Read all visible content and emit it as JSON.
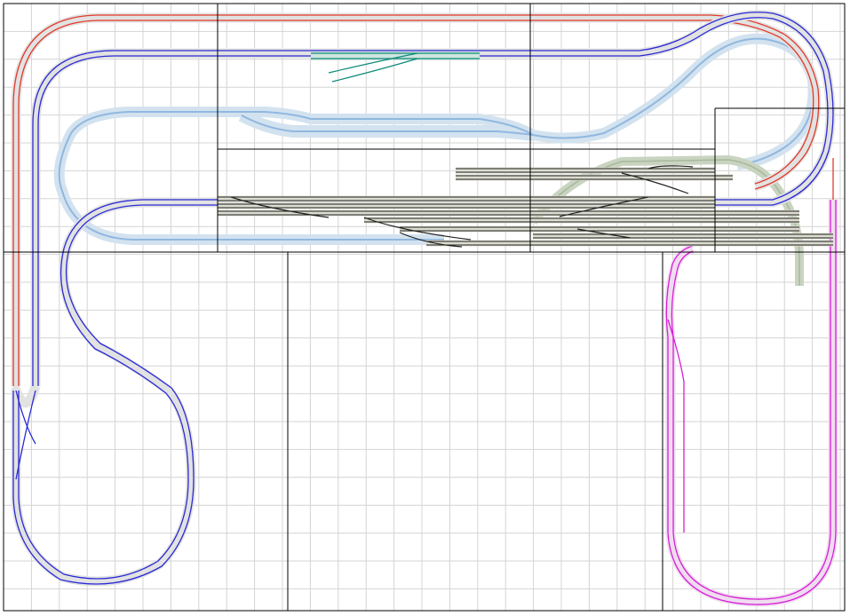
{
  "colors": {
    "background": "#ffffff",
    "grid": "#d4d4d4",
    "board_outline": "#000000",
    "track_bed": "#e2e2e2",
    "red_track": "#e23a2a",
    "blue_track": "#2a2ad6",
    "light_blue_track": "#8fb8e0",
    "light_blue_bed": "#d3e2ef",
    "teal_track": "#0e8a7a",
    "magenta_track": "#d61fd6",
    "yard_track": "#222222",
    "yard_bed": "#dcdcd0",
    "sage_bed": "#c9d4c0"
  },
  "layers": {
    "grid": "grid-lines",
    "boards": "baseboard-outlines",
    "red": "red-mainline",
    "blue": "blue-mainline",
    "light_blue": "light-blue-loop",
    "teal": "teal-siding",
    "magenta": "magenta-loop",
    "yard": "fiddle-yard"
  }
}
